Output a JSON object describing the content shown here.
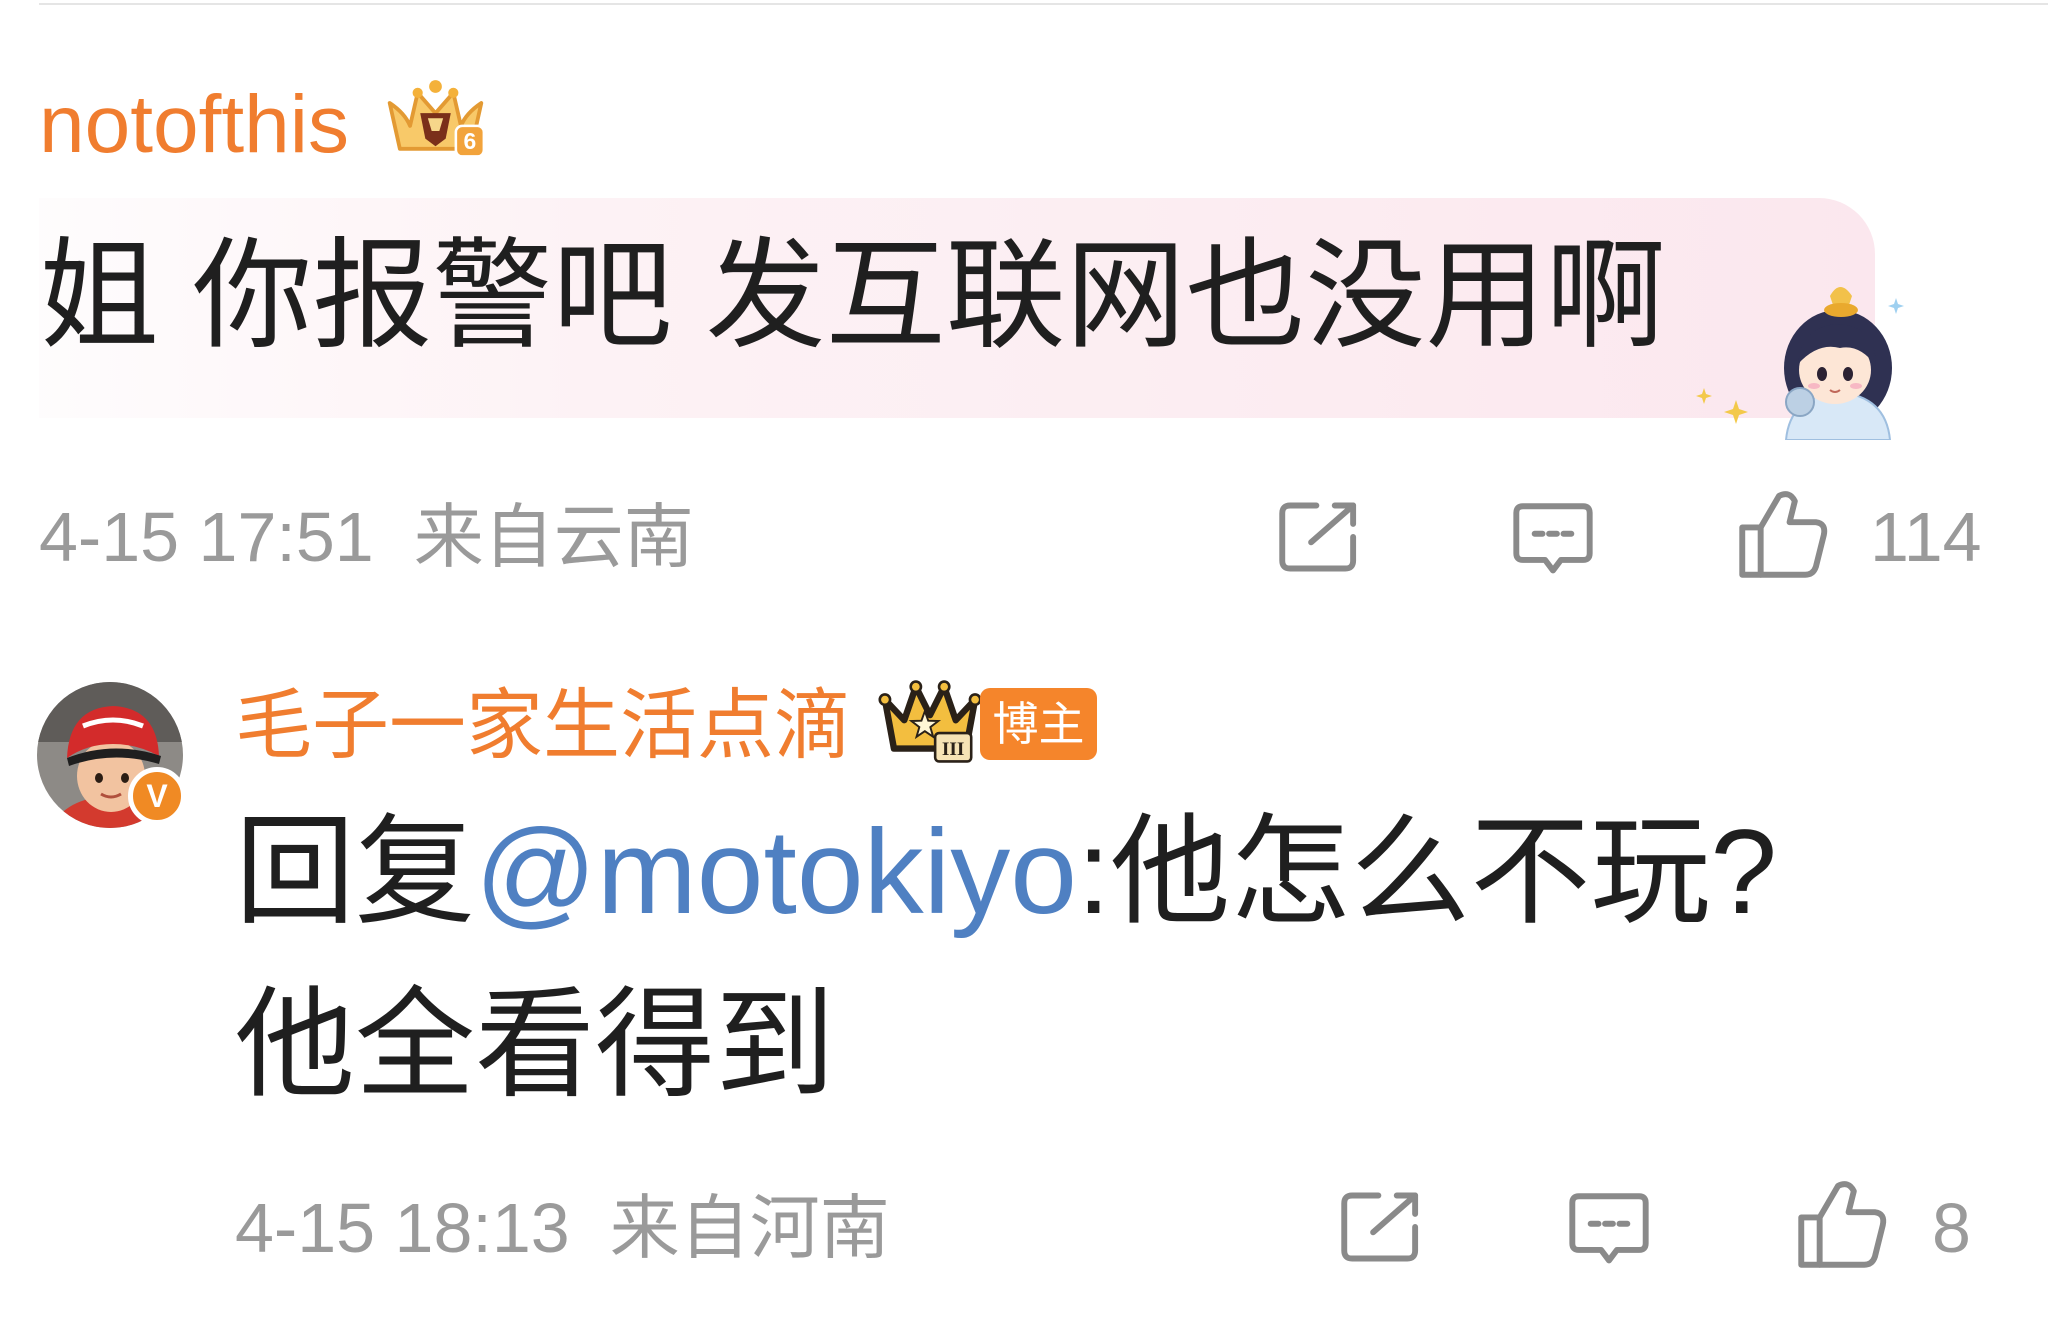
{
  "comments": [
    {
      "username": "notofthis",
      "level_badge": "6",
      "text": "姐 你报警吧 发互联网也没用啊",
      "time": "4-15 17:51",
      "location": "来自云南",
      "like_count": "114",
      "badge_icon": "crown-level-badge-icon",
      "decoration_icon": "chibi-character-sticker-icon",
      "actions": {
        "share": "share-icon",
        "reply": "comment-icon",
        "like": "like-icon"
      }
    },
    {
      "username": "毛子一家生活点滴",
      "verified_mark": "V",
      "level_badge": "III",
      "role_tag": "博主",
      "reply_prefix": "回复",
      "mention": "@motokiyo",
      "text_lines": [
        ":他怎么不玩?",
        "他全看得到"
      ],
      "time": "4-15 18:13",
      "location": "来自河南",
      "like_count": "8",
      "badge_icon": "crown-level-badge-icon",
      "actions": {
        "share": "share-icon",
        "reply": "comment-icon",
        "like": "like-icon"
      }
    }
  ],
  "colors": {
    "username": "#f07d2f",
    "body_text": "#1f1f1f",
    "meta_text": "#9a9a9a",
    "mention": "#4f80c2",
    "icon": "#8a8a8a",
    "role_tag_bg": "#f5852b",
    "highlight_band": "#fbe7ee",
    "divider": "#e5e5e5"
  }
}
